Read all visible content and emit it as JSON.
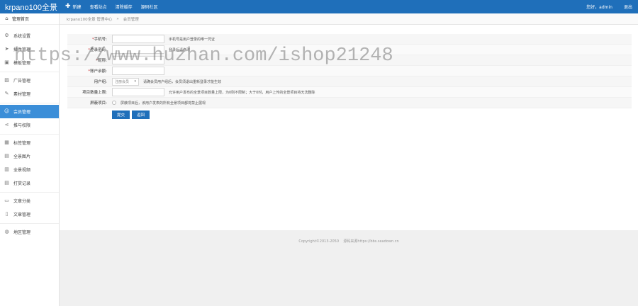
{
  "topbar": {
    "brand": "krpano100全景",
    "nav": [
      {
        "label": "新建",
        "icon": "plus-icon"
      },
      {
        "label": "查看站点"
      },
      {
        "label": "清除缓存"
      },
      {
        "label": "源码社区"
      }
    ],
    "greeting": "您好，admin",
    "logout": "退出"
  },
  "sidebar": {
    "home": "管理首页",
    "groups": [
      [
        {
          "label": "系统设置",
          "icon": "gear-icon"
        },
        {
          "label": "插件管理",
          "icon": "send-icon"
        },
        {
          "label": "模板管理",
          "icon": "template-icon"
        }
      ],
      [
        {
          "label": "广告管理",
          "icon": "image-icon"
        },
        {
          "label": "素材管理",
          "icon": "edit-icon"
        }
      ],
      [
        {
          "label": "会员管理",
          "icon": "user-icon",
          "active": true
        },
        {
          "label": "推与权限",
          "icon": "share-icon"
        }
      ],
      [
        {
          "label": "标签管理",
          "icon": "grid-icon"
        },
        {
          "label": "全景图片",
          "icon": "picture-icon"
        },
        {
          "label": "全景视频",
          "icon": "video-icon"
        },
        {
          "label": "打赏记录",
          "icon": "list-icon"
        }
      ],
      [
        {
          "label": "文章分类",
          "icon": "book-icon"
        },
        {
          "label": "文章管理",
          "icon": "document-icon"
        }
      ],
      [
        {
          "label": "地区管理",
          "icon": "globe-icon"
        }
      ]
    ]
  },
  "breadcrumb": {
    "root": "krpano100全景 管理中心",
    "sep": "»",
    "current": "会员管理"
  },
  "form": {
    "rows": [
      {
        "label": "手机号",
        "required": true,
        "type": "input",
        "hint": "手机号是用户登录的唯一凭证"
      },
      {
        "label": "登录密码",
        "required": true,
        "type": "input",
        "hint": "登录后请修改"
      },
      {
        "label": "昵称",
        "required": true,
        "type": "input",
        "hint": ""
      },
      {
        "label": "账户余额",
        "required": true,
        "type": "input",
        "hint": ""
      },
      {
        "label": "用户组:",
        "required": false,
        "type": "select",
        "value": "注册会员",
        "hint": "请确会员用户组后，会员须退出重新登录才能生效"
      },
      {
        "label": "项目数量上限:",
        "required": false,
        "type": "input",
        "hint": "允许用户发布的全景项目数量上限，为0则不限制；大于0时，用户上传的全景项目将无法删除"
      },
      {
        "label": "屏蔽项目:",
        "required": false,
        "type": "check",
        "hint": "屏蔽项目后，该用户发表的所有全景项目都将禁止展现"
      }
    ],
    "submit": "提交",
    "back": "返回"
  },
  "footer": {
    "copyright": "Copyright©2013-2050",
    "source": "源码来源https://bbs.seadown.cn"
  },
  "watermark": "https://www.huzhan.com/ishop21248"
}
